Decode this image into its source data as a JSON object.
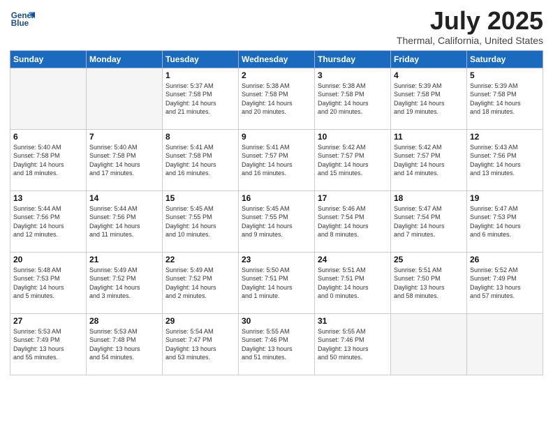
{
  "header": {
    "logo_line1": "General",
    "logo_line2": "Blue",
    "month": "July 2025",
    "location": "Thermal, California, United States"
  },
  "days_of_week": [
    "Sunday",
    "Monday",
    "Tuesday",
    "Wednesday",
    "Thursday",
    "Friday",
    "Saturday"
  ],
  "weeks": [
    [
      {
        "day": "",
        "info": ""
      },
      {
        "day": "",
        "info": ""
      },
      {
        "day": "1",
        "info": "Sunrise: 5:37 AM\nSunset: 7:58 PM\nDaylight: 14 hours\nand 21 minutes."
      },
      {
        "day": "2",
        "info": "Sunrise: 5:38 AM\nSunset: 7:58 PM\nDaylight: 14 hours\nand 20 minutes."
      },
      {
        "day": "3",
        "info": "Sunrise: 5:38 AM\nSunset: 7:58 PM\nDaylight: 14 hours\nand 20 minutes."
      },
      {
        "day": "4",
        "info": "Sunrise: 5:39 AM\nSunset: 7:58 PM\nDaylight: 14 hours\nand 19 minutes."
      },
      {
        "day": "5",
        "info": "Sunrise: 5:39 AM\nSunset: 7:58 PM\nDaylight: 14 hours\nand 18 minutes."
      }
    ],
    [
      {
        "day": "6",
        "info": "Sunrise: 5:40 AM\nSunset: 7:58 PM\nDaylight: 14 hours\nand 18 minutes."
      },
      {
        "day": "7",
        "info": "Sunrise: 5:40 AM\nSunset: 7:58 PM\nDaylight: 14 hours\nand 17 minutes."
      },
      {
        "day": "8",
        "info": "Sunrise: 5:41 AM\nSunset: 7:58 PM\nDaylight: 14 hours\nand 16 minutes."
      },
      {
        "day": "9",
        "info": "Sunrise: 5:41 AM\nSunset: 7:57 PM\nDaylight: 14 hours\nand 16 minutes."
      },
      {
        "day": "10",
        "info": "Sunrise: 5:42 AM\nSunset: 7:57 PM\nDaylight: 14 hours\nand 15 minutes."
      },
      {
        "day": "11",
        "info": "Sunrise: 5:42 AM\nSunset: 7:57 PM\nDaylight: 14 hours\nand 14 minutes."
      },
      {
        "day": "12",
        "info": "Sunrise: 5:43 AM\nSunset: 7:56 PM\nDaylight: 14 hours\nand 13 minutes."
      }
    ],
    [
      {
        "day": "13",
        "info": "Sunrise: 5:44 AM\nSunset: 7:56 PM\nDaylight: 14 hours\nand 12 minutes."
      },
      {
        "day": "14",
        "info": "Sunrise: 5:44 AM\nSunset: 7:56 PM\nDaylight: 14 hours\nand 11 minutes."
      },
      {
        "day": "15",
        "info": "Sunrise: 5:45 AM\nSunset: 7:55 PM\nDaylight: 14 hours\nand 10 minutes."
      },
      {
        "day": "16",
        "info": "Sunrise: 5:45 AM\nSunset: 7:55 PM\nDaylight: 14 hours\nand 9 minutes."
      },
      {
        "day": "17",
        "info": "Sunrise: 5:46 AM\nSunset: 7:54 PM\nDaylight: 14 hours\nand 8 minutes."
      },
      {
        "day": "18",
        "info": "Sunrise: 5:47 AM\nSunset: 7:54 PM\nDaylight: 14 hours\nand 7 minutes."
      },
      {
        "day": "19",
        "info": "Sunrise: 5:47 AM\nSunset: 7:53 PM\nDaylight: 14 hours\nand 6 minutes."
      }
    ],
    [
      {
        "day": "20",
        "info": "Sunrise: 5:48 AM\nSunset: 7:53 PM\nDaylight: 14 hours\nand 5 minutes."
      },
      {
        "day": "21",
        "info": "Sunrise: 5:49 AM\nSunset: 7:52 PM\nDaylight: 14 hours\nand 3 minutes."
      },
      {
        "day": "22",
        "info": "Sunrise: 5:49 AM\nSunset: 7:52 PM\nDaylight: 14 hours\nand 2 minutes."
      },
      {
        "day": "23",
        "info": "Sunrise: 5:50 AM\nSunset: 7:51 PM\nDaylight: 14 hours\nand 1 minute."
      },
      {
        "day": "24",
        "info": "Sunrise: 5:51 AM\nSunset: 7:51 PM\nDaylight: 14 hours\nand 0 minutes."
      },
      {
        "day": "25",
        "info": "Sunrise: 5:51 AM\nSunset: 7:50 PM\nDaylight: 13 hours\nand 58 minutes."
      },
      {
        "day": "26",
        "info": "Sunrise: 5:52 AM\nSunset: 7:49 PM\nDaylight: 13 hours\nand 57 minutes."
      }
    ],
    [
      {
        "day": "27",
        "info": "Sunrise: 5:53 AM\nSunset: 7:49 PM\nDaylight: 13 hours\nand 55 minutes."
      },
      {
        "day": "28",
        "info": "Sunrise: 5:53 AM\nSunset: 7:48 PM\nDaylight: 13 hours\nand 54 minutes."
      },
      {
        "day": "29",
        "info": "Sunrise: 5:54 AM\nSunset: 7:47 PM\nDaylight: 13 hours\nand 53 minutes."
      },
      {
        "day": "30",
        "info": "Sunrise: 5:55 AM\nSunset: 7:46 PM\nDaylight: 13 hours\nand 51 minutes."
      },
      {
        "day": "31",
        "info": "Sunrise: 5:55 AM\nSunset: 7:46 PM\nDaylight: 13 hours\nand 50 minutes."
      },
      {
        "day": "",
        "info": ""
      },
      {
        "day": "",
        "info": ""
      }
    ]
  ]
}
